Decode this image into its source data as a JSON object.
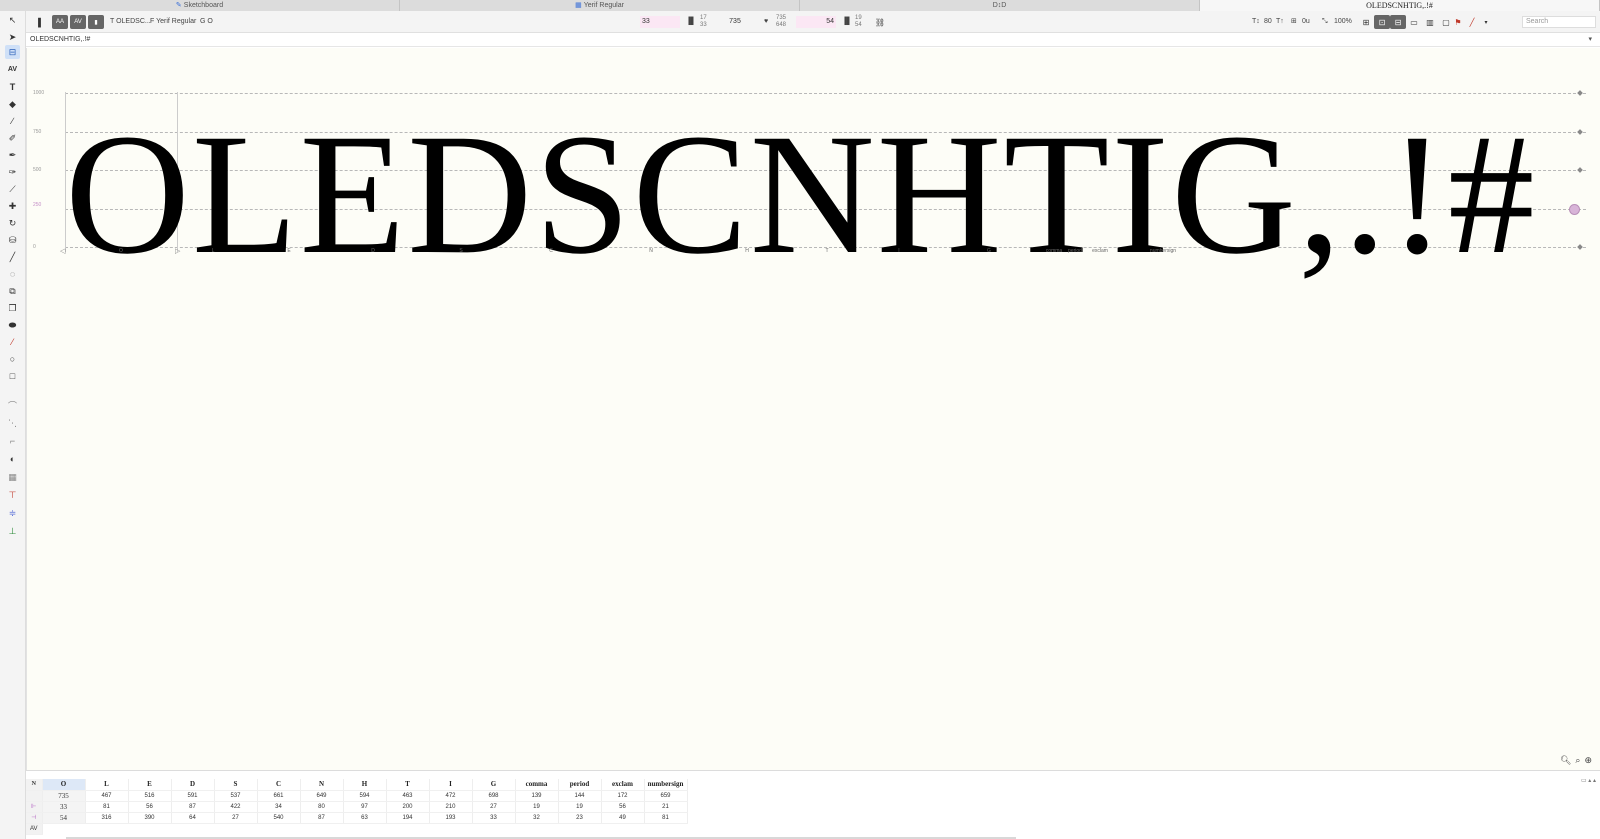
{
  "tabs": [
    {
      "label": "Sketchboard",
      "icon": "brush-icon"
    },
    {
      "label": "Yerif Regular",
      "icon": "grid-icon"
    },
    {
      "label": "D↕D",
      "icon": ""
    },
    {
      "label": "OLEDSCNHTIG,.!#",
      "icon": ""
    }
  ],
  "topbar": {
    "text_label": "T OLEDSC...",
    "font_label": "F Yerif Regular",
    "glyph_label": "G O",
    "lsb": "33",
    "lsb_sub_top": "17",
    "lsb_sub_bottom": "33",
    "width": "735",
    "width_sub_top": "735",
    "width_sub_bottom": "648",
    "rsb": "54",
    "rsb_sub_top": "19",
    "rsb_sub_bottom": "54",
    "size": "80",
    "spacing": "0u",
    "zoom": "100%",
    "search_placeholder": "Search"
  },
  "textline": {
    "value": "OLEDSCNHTIG,.!#"
  },
  "canvas": {
    "glyph_text": "OLEDSCNHTIG,.!#",
    "metric_labels": [
      "1000",
      "750",
      "500",
      "250",
      "0"
    ],
    "glyph_names": [
      "O",
      "L",
      "E",
      "D",
      "S",
      "C",
      "N",
      "H",
      "T",
      "I",
      "G",
      "comma",
      "period",
      "exclam",
      "numbersign"
    ]
  },
  "metrics_table": {
    "corner": "N",
    "headers": [
      "O",
      "L",
      "E",
      "D",
      "S",
      "C",
      "N",
      "H",
      "T",
      "I",
      "G",
      "comma",
      "period",
      "exclam",
      "numbersign"
    ],
    "rows": [
      {
        "label": "",
        "values": [
          "735",
          "467",
          "516",
          "591",
          "537",
          "661",
          "649",
          "594",
          "463",
          "472",
          "698",
          "139",
          "144",
          "172",
          "659"
        ]
      },
      {
        "label": "⊩",
        "values": [
          "33",
          "81",
          "56",
          "87",
          "422",
          "34",
          "80",
          "97",
          "200",
          "210",
          "27",
          "19",
          "19",
          "56",
          "21"
        ]
      },
      {
        "label": "⊣",
        "values": [
          "54",
          "316",
          "390",
          "64",
          "27",
          "540",
          "87",
          "63",
          "194",
          "193",
          "33",
          "32",
          "23",
          "49",
          "81"
        ]
      }
    ],
    "footer_label": "AV"
  }
}
